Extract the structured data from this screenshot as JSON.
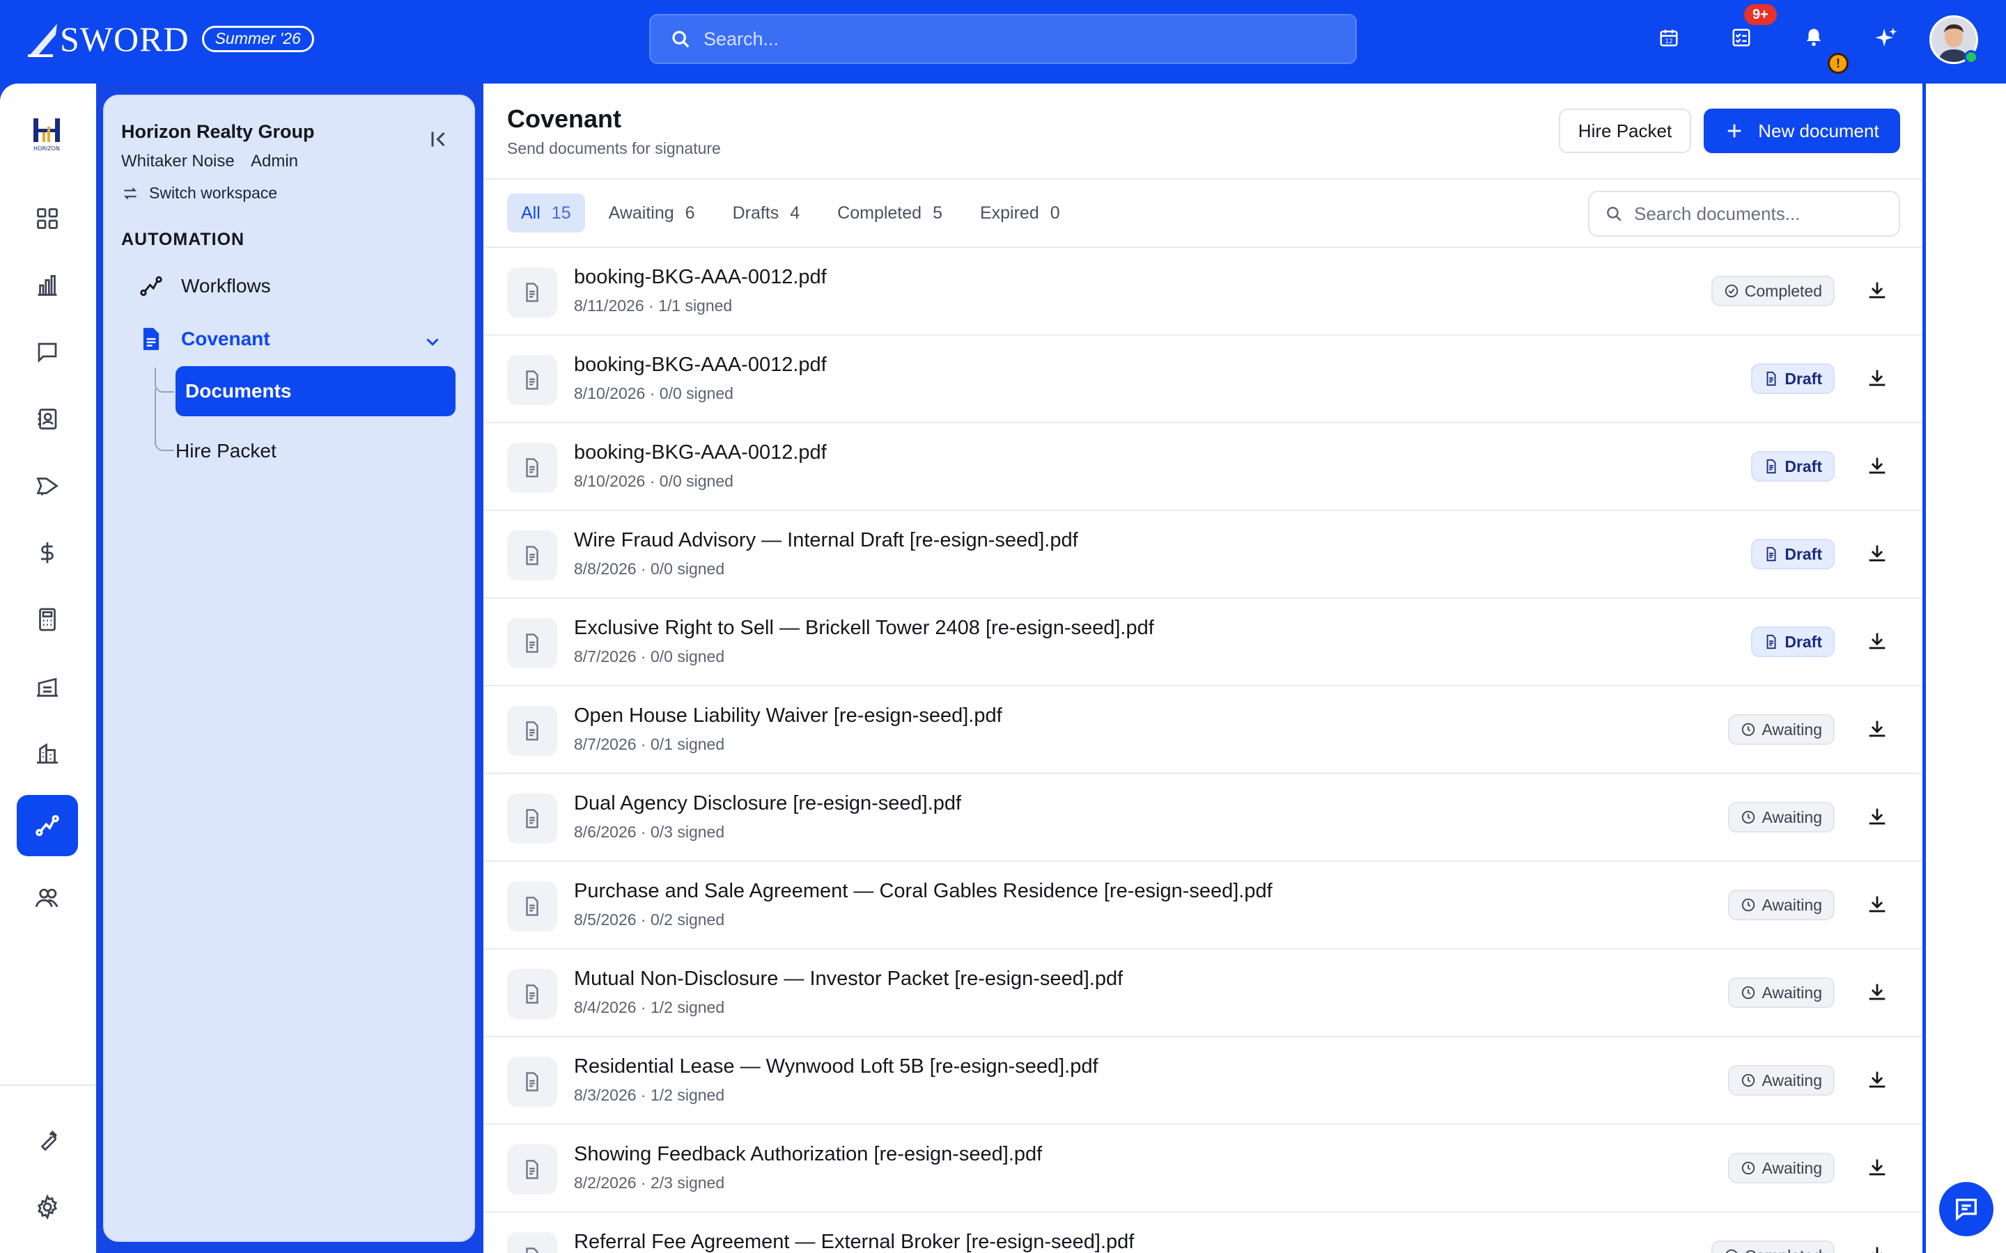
{
  "topbar": {
    "brand_name": "SWORD",
    "season": "Summer '26",
    "search_placeholder": "Search...",
    "tasks_badge": "9+",
    "alert_badge": "!"
  },
  "workspace": {
    "org_name": "Horizon Realty Group",
    "user_name": "Whitaker Noise",
    "role": "Admin",
    "switch_label": "Switch workspace",
    "logo_text": "HORIZON"
  },
  "sidebar": {
    "section_title": "AUTOMATION",
    "items": [
      {
        "label": "Workflows",
        "icon": "workflow-icon"
      },
      {
        "label": "Covenant",
        "icon": "document-icon"
      }
    ],
    "sub_items": [
      {
        "label": "Documents",
        "active": true
      },
      {
        "label": "Hire Packet",
        "active": false
      }
    ]
  },
  "main": {
    "title": "Covenant",
    "subtitle": "Send documents for signature",
    "hire_packet_label": "Hire Packet",
    "new_document_label": "New document",
    "search_placeholder": "Search documents...",
    "tabs": [
      {
        "label": "All",
        "count": "15",
        "active": true
      },
      {
        "label": "Awaiting",
        "count": "6"
      },
      {
        "label": "Drafts",
        "count": "4"
      },
      {
        "label": "Completed",
        "count": "5"
      },
      {
        "label": "Expired",
        "count": "0"
      }
    ],
    "documents": [
      {
        "name": "booking-BKG-AAA-0012.pdf",
        "date": "8/11/2026",
        "signed": "1/1 signed",
        "status": "Completed"
      },
      {
        "name": "booking-BKG-AAA-0012.pdf",
        "date": "8/10/2026",
        "signed": "0/0 signed",
        "status": "Draft"
      },
      {
        "name": "booking-BKG-AAA-0012.pdf",
        "date": "8/10/2026",
        "signed": "0/0 signed",
        "status": "Draft"
      },
      {
        "name": "Wire Fraud Advisory — Internal Draft [re-esign-seed].pdf",
        "date": "8/8/2026",
        "signed": "0/0 signed",
        "status": "Draft"
      },
      {
        "name": "Exclusive Right to Sell — Brickell Tower 2408 [re-esign-seed].pdf",
        "date": "8/7/2026",
        "signed": "0/0 signed",
        "status": "Draft"
      },
      {
        "name": "Open House Liability Waiver [re-esign-seed].pdf",
        "date": "8/7/2026",
        "signed": "0/1 signed",
        "status": "Awaiting"
      },
      {
        "name": "Dual Agency Disclosure [re-esign-seed].pdf",
        "date": "8/6/2026",
        "signed": "0/3 signed",
        "status": "Awaiting"
      },
      {
        "name": "Purchase and Sale Agreement — Coral Gables Residence [re-esign-seed].pdf",
        "date": "8/5/2026",
        "signed": "0/2 signed",
        "status": "Awaiting"
      },
      {
        "name": "Mutual Non-Disclosure — Investor Packet [re-esign-seed].pdf",
        "date": "8/4/2026",
        "signed": "1/2 signed",
        "status": "Awaiting"
      },
      {
        "name": "Residential Lease — Wynwood Loft 5B [re-esign-seed].pdf",
        "date": "8/3/2026",
        "signed": "1/2 signed",
        "status": "Awaiting"
      },
      {
        "name": "Showing Feedback Authorization [re-esign-seed].pdf",
        "date": "8/2/2026",
        "signed": "2/3 signed",
        "status": "Awaiting"
      },
      {
        "name": "Referral Fee Agreement — External Broker [re-esign-seed].pdf",
        "date": "",
        "signed": "",
        "status": "Completed"
      }
    ]
  },
  "rail_icons": [
    "dashboard-icon",
    "analytics-icon",
    "messages-icon",
    "contacts-icon",
    "campaigns-icon",
    "billing-icon",
    "calculator-icon",
    "inventory-icon",
    "properties-icon",
    "automation-icon",
    "team-icon"
  ],
  "rail_bottom_icons": [
    "tools-icon",
    "settings-icon"
  ],
  "colors": {
    "brand_blue": "#0d47ef",
    "panel_bg": "#dbe6fb",
    "badge_red": "#e5322d",
    "online_green": "#22c55e"
  }
}
